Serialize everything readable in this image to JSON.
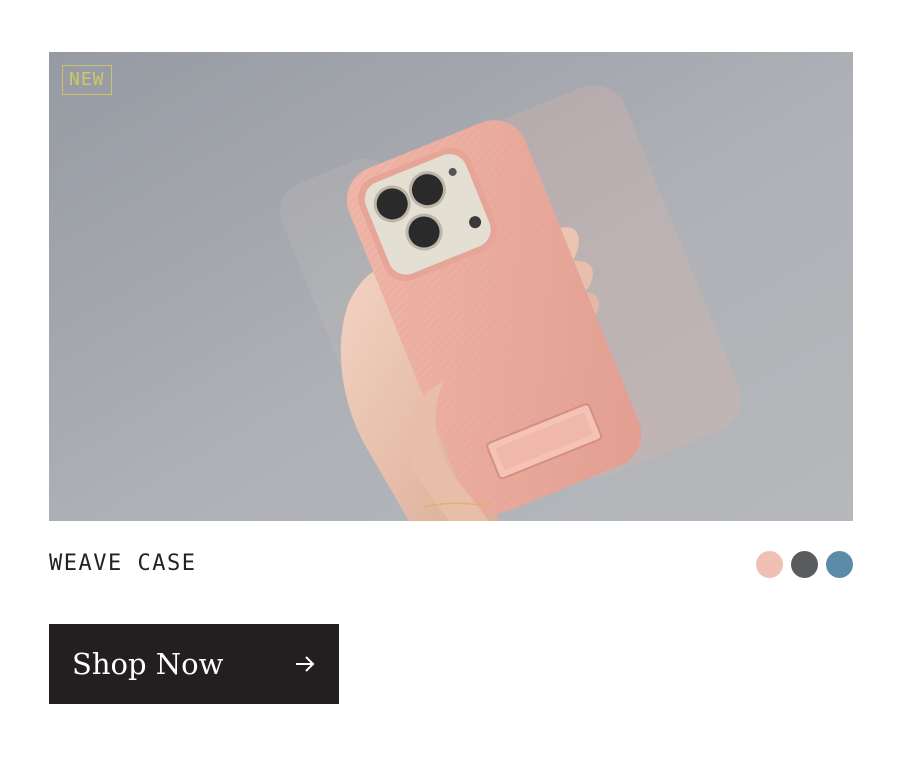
{
  "product": {
    "badge": "NEW",
    "name": "WEAVE CASE",
    "image_alt": "Hand holding phone with pink woven case",
    "swatches": [
      {
        "name": "pink",
        "color": "#f1c0b4"
      },
      {
        "name": "charcoal",
        "color": "#5a5b5d"
      },
      {
        "name": "blue",
        "color": "#5b8ca7"
      }
    ]
  },
  "cta": {
    "label": "Shop Now",
    "icon": "arrow-right-icon"
  },
  "colors": {
    "button_bg": "#231f20",
    "badge": "#c9c36a"
  }
}
